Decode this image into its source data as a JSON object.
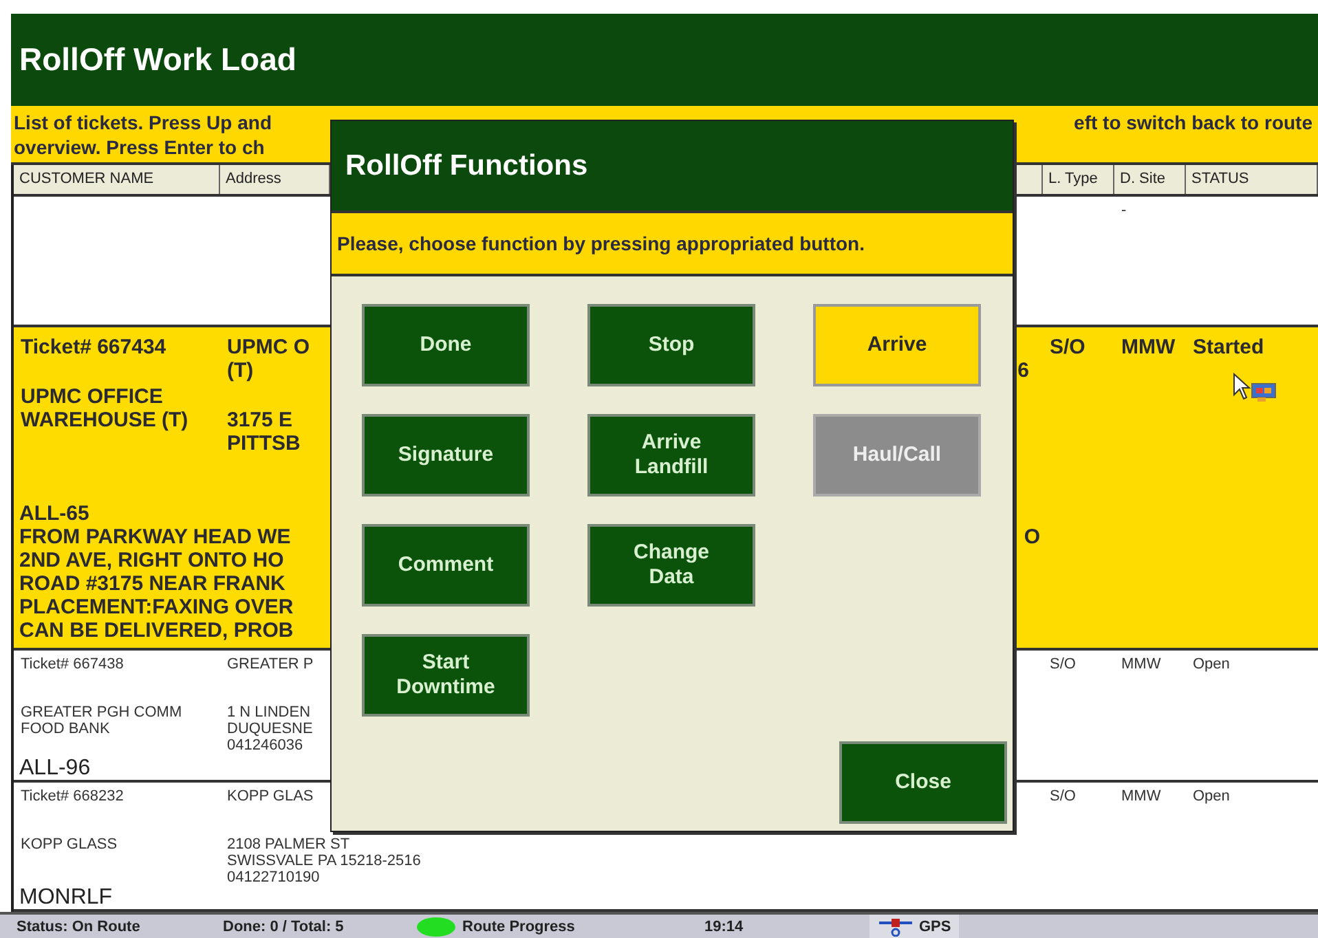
{
  "app": {
    "title": "RollOff Work Load"
  },
  "instructions": {
    "line_1_left": "List of tickets. Press Up and",
    "line_1_right": "eft to switch back to route",
    "line_2": "overview. Press Enter to ch"
  },
  "table": {
    "columns": [
      "CUSTOMER NAME",
      "Address",
      "L. Type",
      "D. Site",
      "STATUS"
    ],
    "rows": [
      {
        "selected": false,
        "d_site": "-"
      },
      {
        "selected": true,
        "ticket": "Ticket# 667434",
        "customer": [
          "UPMC OFFICE",
          "WAREHOUSE (T)"
        ],
        "site": [
          "UPMC O",
          "(T)"
        ],
        "address": [
          "3175 E",
          "PITTSB"
        ],
        "column_3": "6",
        "l_type": "S/O",
        "d_site": "MMW",
        "status": "Started",
        "notes": [
          {
            "text": "ALL-65"
          },
          {
            "text": "FROM PARKWAY HEAD WE",
            "column_3": "O"
          },
          {
            "text": "2ND AVE, RIGHT ONTO HO"
          },
          {
            "text": "ROAD #3175 NEAR FRANK"
          },
          {
            "text": "PLACEMENT:FAXING OVER"
          },
          {
            "text": "CAN BE DELIVERED, PROB"
          }
        ]
      },
      {
        "selected": false,
        "ticket": "Ticket# 667438",
        "customer": [
          "GREATER PGH COMM",
          "FOOD BANK"
        ],
        "site": [
          "GREATER P"
        ],
        "address": [
          "1 N LINDEN",
          "DUQUESNE",
          "041246036"
        ],
        "l_type": "S/O",
        "d_site": "MMW",
        "status": "Open",
        "notes": [
          {
            "text": "ALL-96"
          }
        ]
      },
      {
        "selected": false,
        "ticket": "Ticket# 668232",
        "customer": [
          "KOPP GLASS"
        ],
        "site": [
          "KOPP GLAS"
        ],
        "address": [
          "2108 PALMER ST",
          "SWISSVALE PA 15218-2516",
          "04122710190"
        ],
        "l_type": "S/O",
        "d_site": "MMW",
        "status": "Open",
        "notes": [
          {
            "text": "MONRLF"
          }
        ]
      }
    ]
  },
  "dialog": {
    "title": "RollOff Functions",
    "prompt": "Please, choose function by pressing appropriated button.",
    "button_rows": [
      [
        {
          "label": "Done",
          "selected": false,
          "disabled": false
        },
        {
          "label": "Stop",
          "selected": false,
          "disabled": false
        },
        {
          "label": "Arrive",
          "selected": true,
          "disabled": false
        }
      ],
      [
        {
          "label": "Signature",
          "selected": false,
          "disabled": false
        },
        {
          "label": "Arrive Landfill",
          "selected": false,
          "disabled": false
        },
        {
          "label": "Haul/Call",
          "selected": false,
          "disabled": true
        }
      ],
      [
        {
          "label": "Comment",
          "selected": false,
          "disabled": false
        },
        {
          "label": "Change Data",
          "selected": false,
          "disabled": false
        }
      ],
      [
        {
          "label": "Start Downtime",
          "selected": false,
          "disabled": false
        }
      ]
    ],
    "close": "Close"
  },
  "status_bar": {
    "status": "Status: On Route",
    "count": "Done: 0 / Total: 5",
    "route_progress": "Route Progress",
    "time": "19:14",
    "gps": "GPS"
  }
}
